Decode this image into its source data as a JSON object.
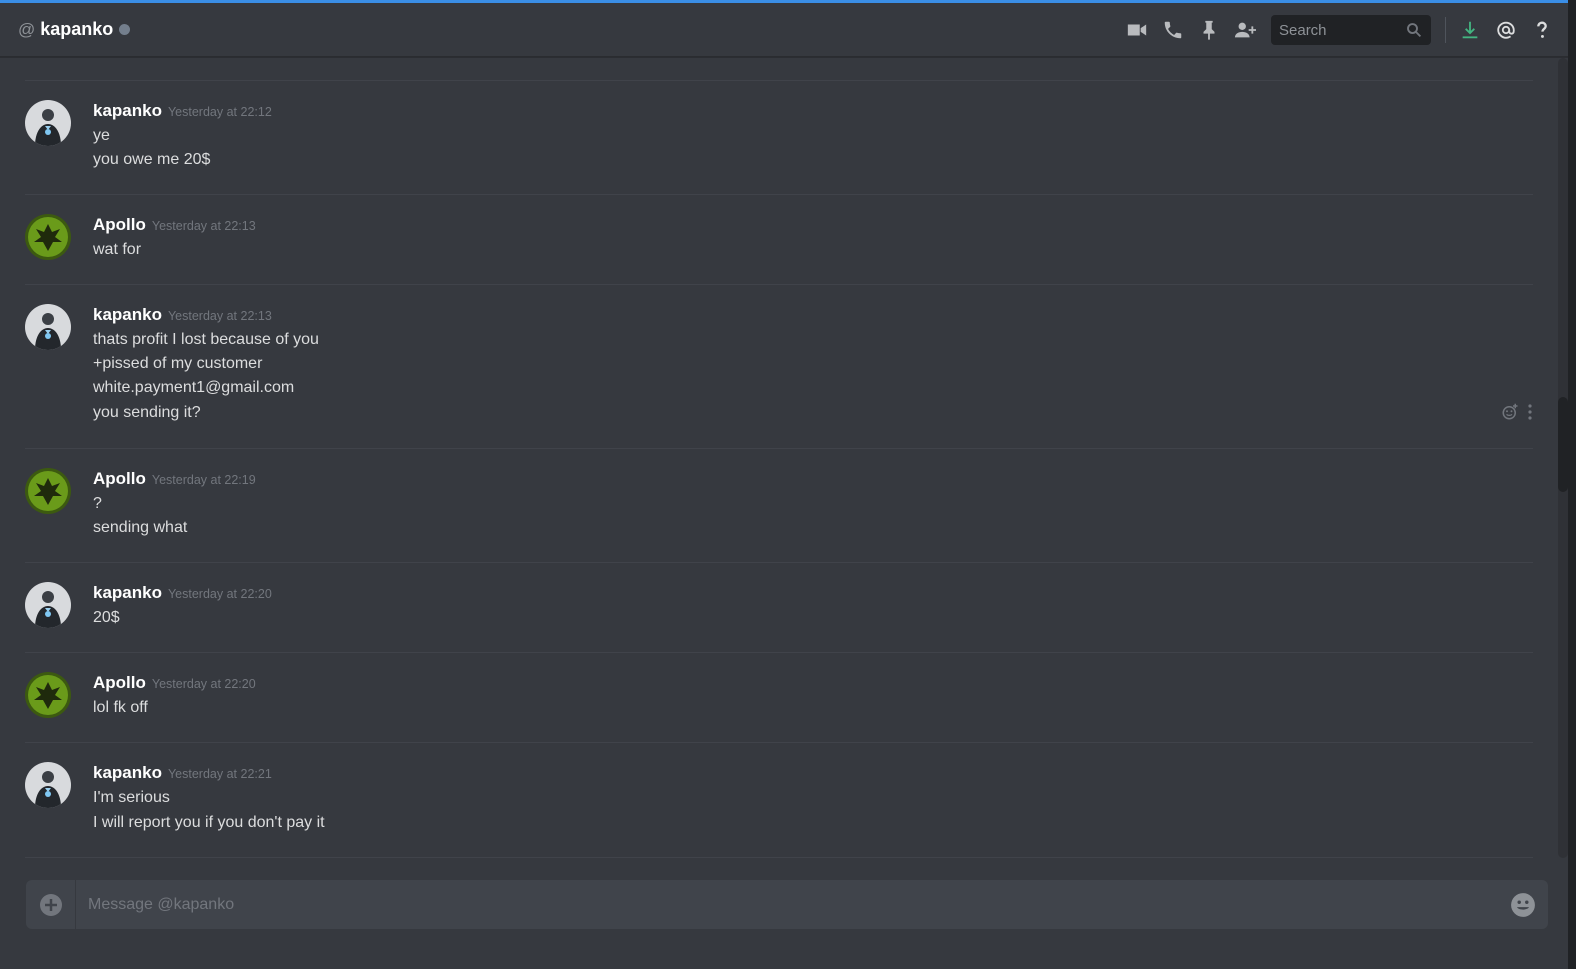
{
  "header": {
    "at_symbol": "@",
    "channel_name": "kapanko",
    "search_placeholder": "Search",
    "icons": [
      "video-call-icon",
      "voice-call-icon",
      "pin-icon",
      "add-friend-icon",
      "search-icon",
      "download-icon",
      "mention-icon",
      "help-icon"
    ]
  },
  "colors": {
    "background": "#36393f",
    "accent": "#3a8ee6",
    "download_icon": "#43b581",
    "status_offline": "#747f8d",
    "username": "#ffffff",
    "timestamp": "#72767d"
  },
  "messages": [
    {
      "author": "kapanko",
      "timestamp": "Yesterday at 22:12",
      "avatar": "kapanko-avatar",
      "lines": [
        "ye",
        "you owe me 20$"
      ]
    },
    {
      "author": "Apollo",
      "timestamp": "Yesterday at 22:13",
      "avatar": "apollo-avatar",
      "lines": [
        "wat for"
      ]
    },
    {
      "author": "kapanko",
      "timestamp": "Yesterday at 22:13",
      "avatar": "kapanko-avatar",
      "lines": [
        "thats profit I lost because of you",
        "+pissed of my customer",
        "white.payment1@gmail.com",
        "you sending it?"
      ]
    },
    {
      "author": "Apollo",
      "timestamp": "Yesterday at 22:19",
      "avatar": "apollo-avatar",
      "lines": [
        "?",
        "sending what"
      ]
    },
    {
      "author": "kapanko",
      "timestamp": "Yesterday at 22:20",
      "avatar": "kapanko-avatar",
      "lines": [
        "20$"
      ]
    },
    {
      "author": "Apollo",
      "timestamp": "Yesterday at 22:20",
      "avatar": "apollo-avatar",
      "lines": [
        "lol fk off"
      ]
    },
    {
      "author": "kapanko",
      "timestamp": "Yesterday at 22:21",
      "avatar": "kapanko-avatar",
      "lines": [
        "I'm serious",
        "I will report you if you don't pay it"
      ]
    }
  ],
  "composer": {
    "placeholder": "Message @kapanko",
    "upload_icon": "plus-circle-icon",
    "emoji_icon": "emoji-icon"
  }
}
